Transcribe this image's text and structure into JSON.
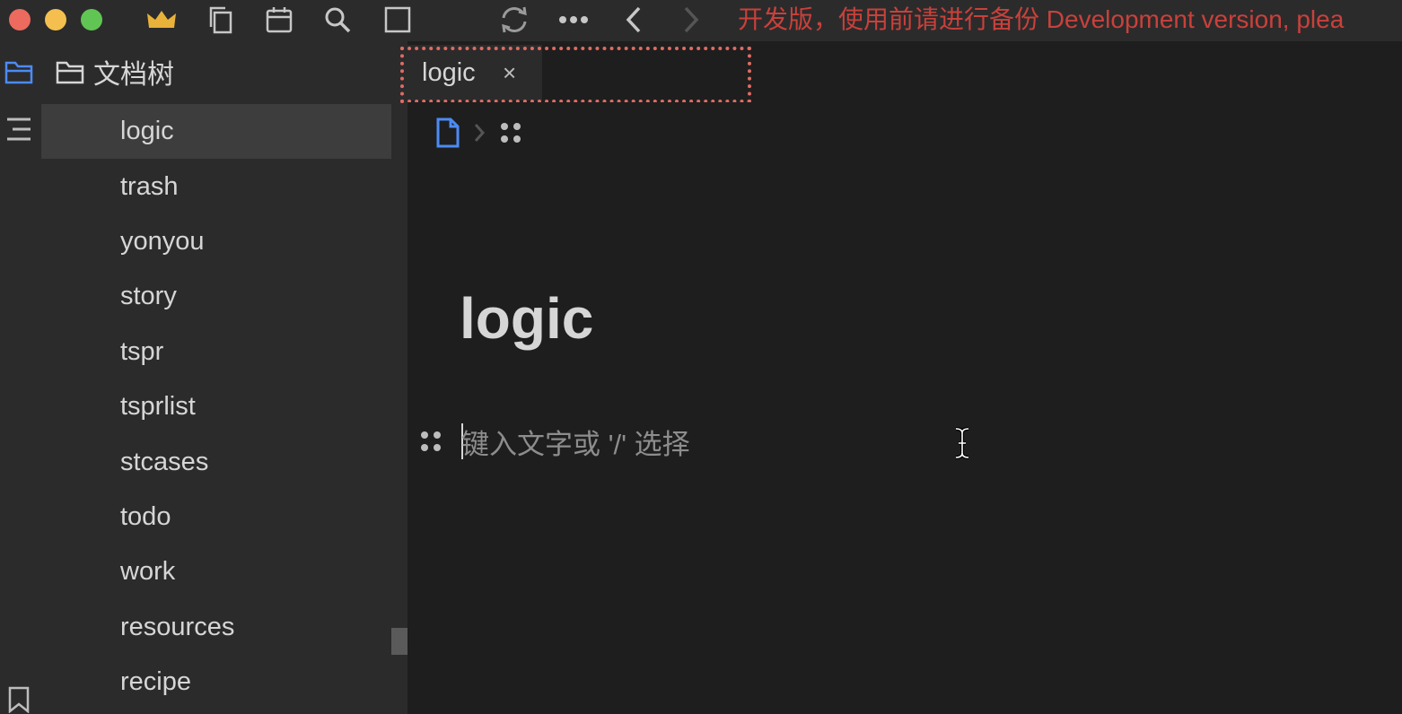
{
  "titlebar": {
    "dev_banner": "开发版，使用前请进行备份 Development version, plea",
    "icons": [
      "crown-icon",
      "copy-icon",
      "calendar-icon",
      "search-icon",
      "square-icon",
      "sync-icon",
      "more-icon",
      "back-icon",
      "forward-icon"
    ]
  },
  "tree": {
    "title": "文档树",
    "items": [
      "logic",
      "trash",
      "yonyou",
      "story",
      "tspr",
      "tsprlist",
      "stcases",
      "todo",
      "work",
      "resources",
      "recipe"
    ],
    "active_index": 0
  },
  "tabs": [
    {
      "label": "logic",
      "close": "×"
    }
  ],
  "editor": {
    "title": "logic",
    "placeholder": "键入文字或 '/' 选择"
  },
  "colors": {
    "accent": "#4c8bf5",
    "banner": "#c9413a",
    "focus_outline": "#e06b63"
  }
}
